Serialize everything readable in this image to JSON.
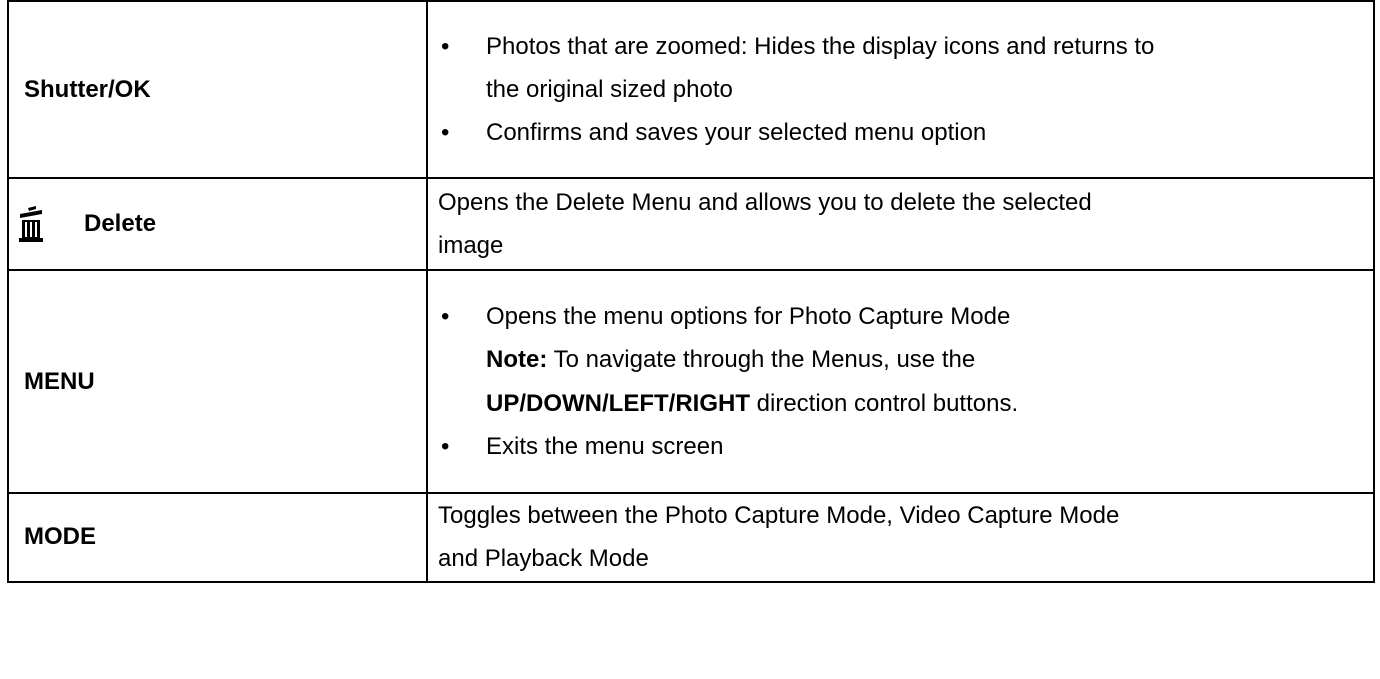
{
  "rows": [
    {
      "label": "Shutter/OK",
      "bullets": [
        {
          "line1": "Photos that are zoomed: Hides the display icons and returns to",
          "line2": "the original sized photo"
        },
        {
          "line1": "Confirms and saves your selected menu option"
        }
      ]
    },
    {
      "label": "Delete",
      "icon": "trash-icon",
      "lines": [
        "Opens the Delete Menu and allows you to delete the selected",
        "image"
      ]
    },
    {
      "label": "MENU",
      "bullet1": "Opens the menu options for Photo Capture Mode",
      "note_label": "Note:",
      "note_text": " To navigate through the Menus, use the",
      "note_bold": "UP/DOWN/LEFT/RIGHT",
      "note_tail": " direction control buttons.",
      "bullet2": "Exits the menu screen"
    },
    {
      "label": "MODE",
      "lines": [
        "Toggles between the Photo Capture Mode, Video Capture Mode",
        "and Playback Mode"
      ]
    }
  ],
  "bullet_glyph": "•"
}
